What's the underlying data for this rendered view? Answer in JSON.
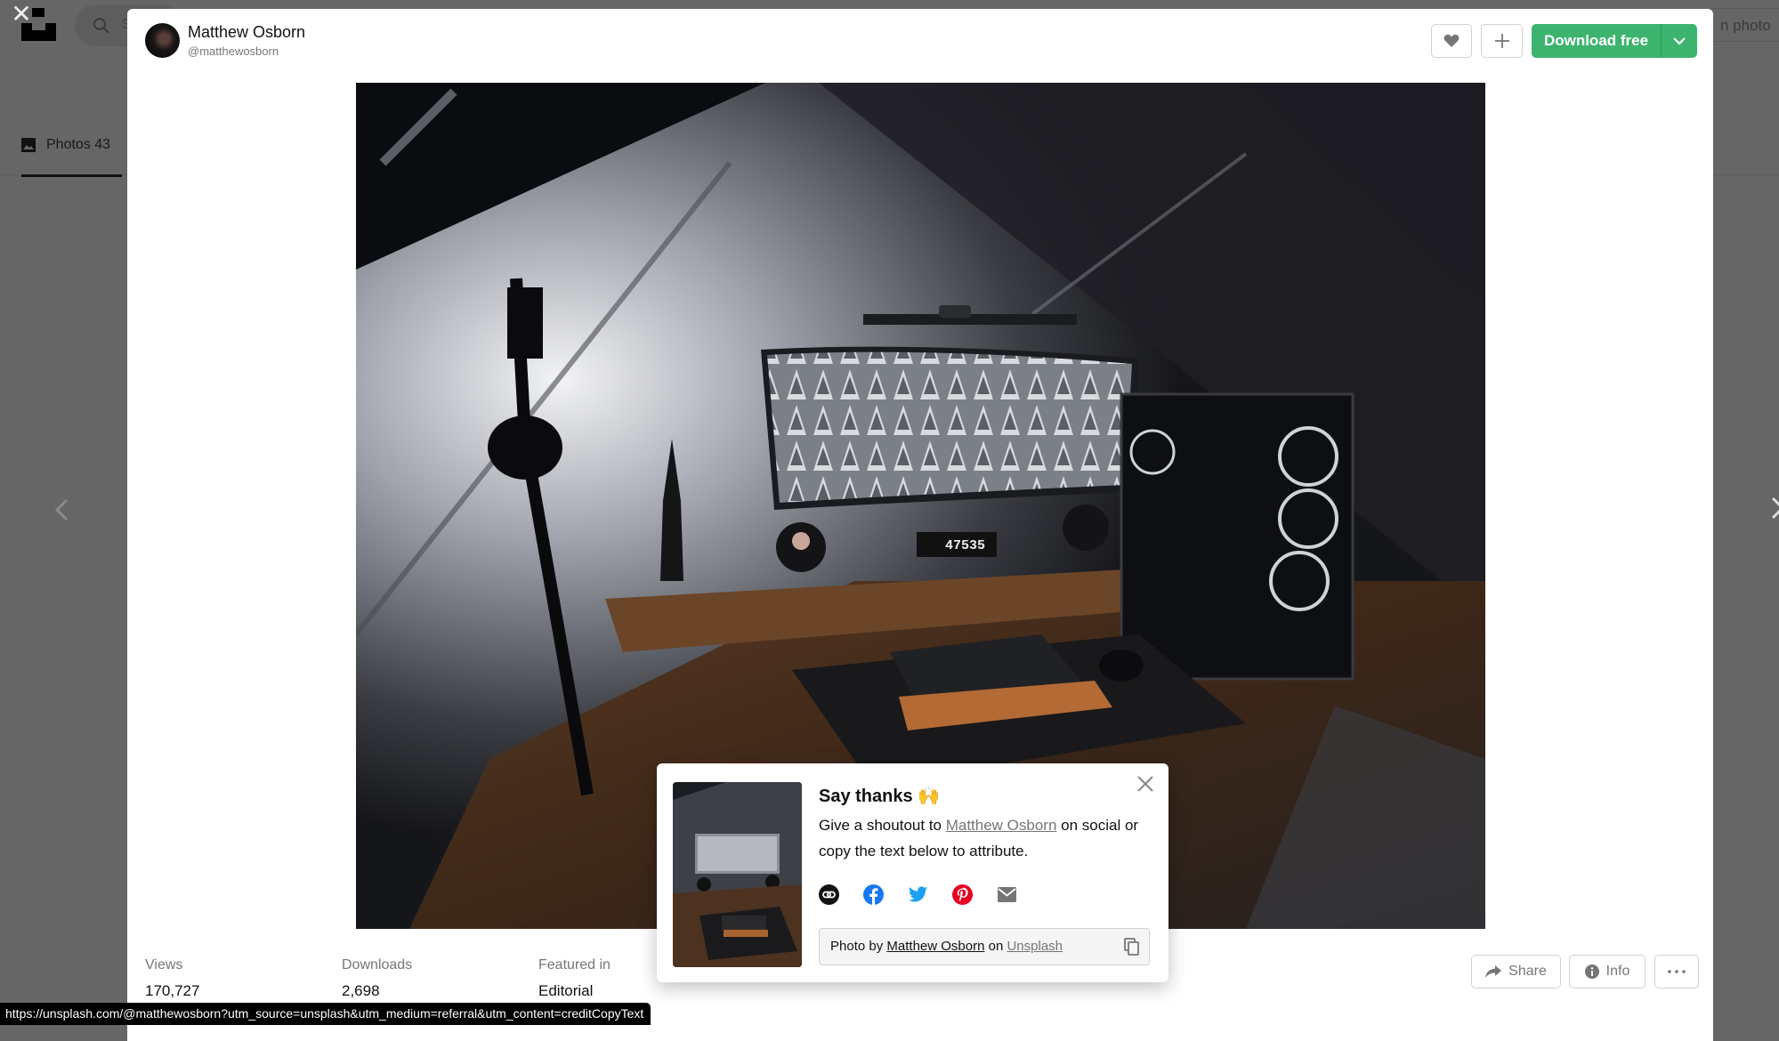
{
  "background": {
    "search_placeholder_visible": "S",
    "submit_button_partial": "n photo",
    "tab": {
      "label": "Photos",
      "count": "43",
      "icon": "image-icon"
    },
    "close_icon": "close-icon",
    "nav": {
      "prev_icon": "chevron-left-icon",
      "next_icon": "chevron-right-icon"
    }
  },
  "modal": {
    "author": {
      "name": "Matthew Osborn",
      "handle": "@matthewosborn"
    },
    "actions": {
      "like_icon": "heart-icon",
      "add_icon": "plus-icon",
      "download_label": "Download free",
      "download_dropdown_icon": "chevron-down-icon",
      "accent_color": "#3cb46e"
    },
    "photo": {
      "description": "Desk setup with ultrawide monitor showing snowy forest, PC case, keyboard, microphone",
      "clock_display": "47535"
    },
    "stats": [
      {
        "label": "Views",
        "value": "170,727"
      },
      {
        "label": "Downloads",
        "value": "2,698"
      },
      {
        "label": "Featured in",
        "value": "Editorial"
      }
    ],
    "footer_actions": {
      "share_label": "Share",
      "info_label": "Info",
      "more_icon": "more-horizontal-icon"
    }
  },
  "say_thanks": {
    "title": "Say thanks",
    "emoji": "🙌",
    "body_prefix": "Give a shoutout to ",
    "author_link": "Matthew Osborn",
    "body_suffix": " on social or copy the text below to attribute.",
    "social_icons": [
      "link-icon",
      "facebook-icon",
      "twitter-icon",
      "pinterest-icon",
      "email-icon"
    ],
    "attribution": {
      "prefix": "Photo by ",
      "author": "Matthew Osborn",
      "middle": " on ",
      "site": "Unsplash"
    }
  },
  "status_bar": {
    "url": "https://unsplash.com/@matthewosborn?utm_source=unsplash&utm_medium=referral&utm_content=creditCopyText"
  }
}
